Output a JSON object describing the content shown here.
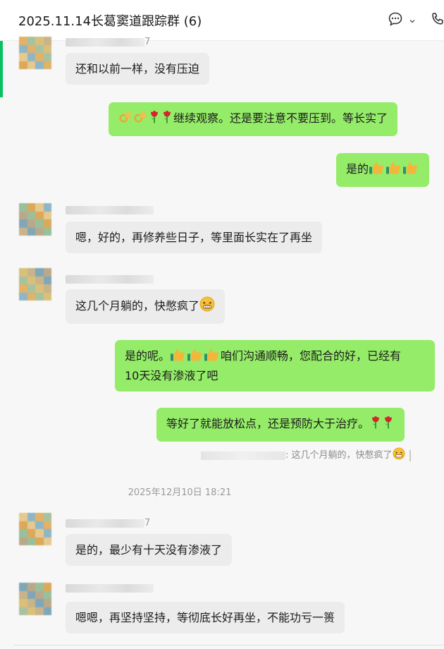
{
  "header": {
    "title": "2025.11.14长葛窦道跟踪群 (6)",
    "chat_icon": "chat-bubble-icon",
    "dropdown_icon": "chevron-down-icon",
    "call_icon": "phone-icon"
  },
  "colors": {
    "incoming_bubble": "#ececec",
    "outgoing_bubble": "#95ec69",
    "accent": "#07c160",
    "background": "#f7f7f8"
  },
  "messages": [
    {
      "id": "m1",
      "dir": "in",
      "sender_suffix": "7",
      "text": "还和以前一样，没有压迫"
    },
    {
      "id": "m2",
      "dir": "out",
      "prefix_icons": [
        "ok-hand-icon",
        "ok-hand-icon",
        "rose-icon",
        "rose-icon"
      ],
      "text": "继续观察。还是要注意不要压到。等长实了"
    },
    {
      "id": "m3",
      "dir": "out",
      "text": "是的",
      "suffix_icons": [
        "thumbs-up-icon",
        "thumbs-up-icon",
        "thumbs-up-icon"
      ]
    },
    {
      "id": "m4",
      "dir": "in",
      "text": "嗯，好的，再修养些日子，等里面长实在了再坐"
    },
    {
      "id": "m5",
      "dir": "in",
      "text": "这几个月躺的，快憋疯了",
      "suffix_icons": [
        "grin-icon"
      ]
    },
    {
      "id": "m6",
      "dir": "out",
      "text_a": "是的呢。",
      "mid_icons": [
        "thumbs-up-icon",
        "thumbs-up-icon",
        "thumbs-up-icon"
      ],
      "text_b": "咱们沟通顺畅，您配合的好，已经有",
      "text_c": "10天没有渗液了吧"
    },
    {
      "id": "m7",
      "dir": "out",
      "text": "等好了就能放松点，还是预防大于治疗。",
      "suffix_icons": [
        "rose-icon",
        "rose-icon"
      ]
    },
    {
      "id": "m8",
      "dir": "in",
      "sender_suffix": "7",
      "text": "是的，最少有十天没有渗液了"
    },
    {
      "id": "m9",
      "dir": "in",
      "text": "嗯嗯，再坚持坚持，等彻底长好再坐，不能功亏一篑"
    }
  ],
  "quote": {
    "text": ": 这几个月躺的，快憋疯了",
    "icon": "grin-icon"
  },
  "timestamp": "2025年12月10日 18:21"
}
